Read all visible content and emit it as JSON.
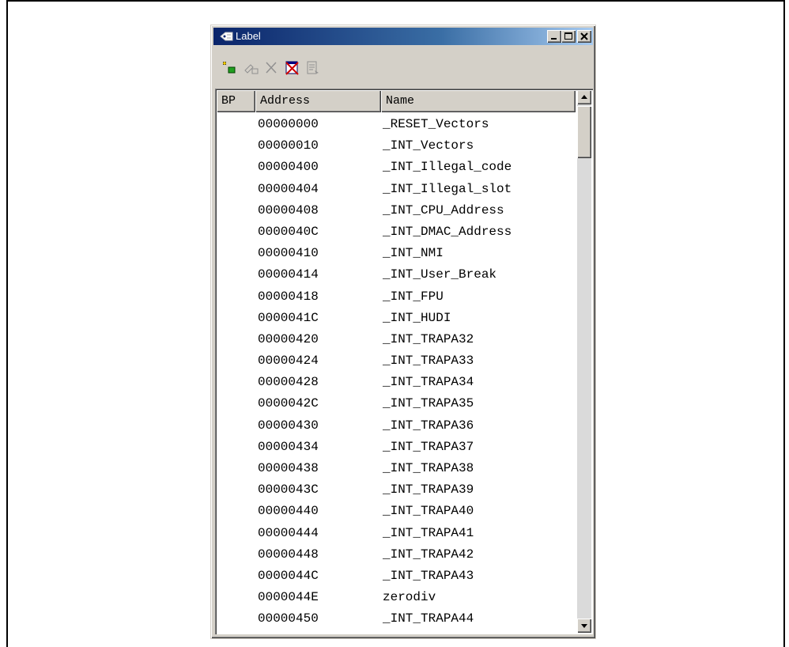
{
  "window": {
    "title": "Label",
    "icon": "label-window-icon",
    "controls": [
      "minimize",
      "maximize",
      "close"
    ]
  },
  "toolbar": {
    "buttons": [
      {
        "name": "add-label",
        "icon": "add-label-icon",
        "enabled": true
      },
      {
        "name": "edit-label",
        "icon": "edit-label-icon",
        "enabled": false
      },
      {
        "name": "delete-label",
        "icon": "delete-icon",
        "enabled": false
      },
      {
        "name": "delete-all-labels",
        "icon": "delete-all-icon",
        "enabled": true
      },
      {
        "name": "view-source",
        "icon": "view-source-icon",
        "enabled": false
      }
    ]
  },
  "table": {
    "columns": [
      "BP",
      "Address",
      "Name"
    ],
    "rows": [
      {
        "bp": "",
        "address": "00000000",
        "name": "_RESET_Vectors"
      },
      {
        "bp": "",
        "address": "00000010",
        "name": "_INT_Vectors"
      },
      {
        "bp": "",
        "address": "00000400",
        "name": "_INT_Illegal_code"
      },
      {
        "bp": "",
        "address": "00000404",
        "name": "_INT_Illegal_slot"
      },
      {
        "bp": "",
        "address": "00000408",
        "name": "_INT_CPU_Address"
      },
      {
        "bp": "",
        "address": "0000040C",
        "name": "_INT_DMAC_Address"
      },
      {
        "bp": "",
        "address": "00000410",
        "name": "_INT_NMI"
      },
      {
        "bp": "",
        "address": "00000414",
        "name": "_INT_User_Break"
      },
      {
        "bp": "",
        "address": "00000418",
        "name": "_INT_FPU"
      },
      {
        "bp": "",
        "address": "0000041C",
        "name": "_INT_HUDI"
      },
      {
        "bp": "",
        "address": "00000420",
        "name": "_INT_TRAPA32"
      },
      {
        "bp": "",
        "address": "00000424",
        "name": "_INT_TRAPA33"
      },
      {
        "bp": "",
        "address": "00000428",
        "name": "_INT_TRAPA34"
      },
      {
        "bp": "",
        "address": "0000042C",
        "name": "_INT_TRAPA35"
      },
      {
        "bp": "",
        "address": "00000430",
        "name": "_INT_TRAPA36"
      },
      {
        "bp": "",
        "address": "00000434",
        "name": "_INT_TRAPA37"
      },
      {
        "bp": "",
        "address": "00000438",
        "name": "_INT_TRAPA38"
      },
      {
        "bp": "",
        "address": "0000043C",
        "name": "_INT_TRAPA39"
      },
      {
        "bp": "",
        "address": "00000440",
        "name": "_INT_TRAPA40"
      },
      {
        "bp": "",
        "address": "00000444",
        "name": "_INT_TRAPA41"
      },
      {
        "bp": "",
        "address": "00000448",
        "name": "_INT_TRAPA42"
      },
      {
        "bp": "",
        "address": "0000044C",
        "name": "_INT_TRAPA43"
      },
      {
        "bp": "",
        "address": "0000044E",
        "name": "zerodiv"
      },
      {
        "bp": "",
        "address": "00000450",
        "name": "_INT_TRAPA44"
      }
    ]
  },
  "colors": {
    "title_start": "#0a246a",
    "title_end": "#a6caf0",
    "face": "#d4d0c8"
  }
}
